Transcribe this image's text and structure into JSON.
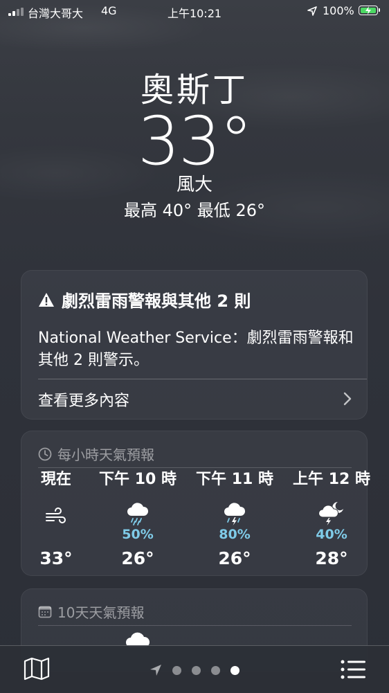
{
  "status_bar": {
    "carrier": "台灣大哥大",
    "network": "4G",
    "time": "上午10:21",
    "battery": "100%"
  },
  "location": {
    "city": "奧斯丁",
    "temperature": "33°",
    "condition": "風大",
    "high_low": "最高 40°  最低 26°"
  },
  "alert": {
    "title": "劇烈雷雨警報與其他 2 則",
    "body": "National Weather Service：劇烈雷雨警報和其他 2 則警示。",
    "more_label": "查看更多內容",
    "icon": "warning-triangle-icon"
  },
  "hourly": {
    "title": "每小時天氣預報",
    "icon": "clock-icon",
    "items": [
      {
        "time": "現在",
        "icon": "wind-icon",
        "pop": "",
        "temp": "33°"
      },
      {
        "time": "下午 10 時",
        "icon": "rain-cloud-icon",
        "pop": "50%",
        "temp": "26°"
      },
      {
        "time": "下午 11 時",
        "icon": "thunderstorm-cloud-icon",
        "pop": "80%",
        "temp": "26°"
      },
      {
        "time": "上午 12 時",
        "icon": "moon-thunderstorm-icon",
        "pop": "40%",
        "temp": "28°"
      }
    ]
  },
  "ten_day": {
    "title": "10天天氣預報",
    "icon": "calendar-icon"
  },
  "toolbar": {
    "map_icon": "map-icon",
    "list_icon": "list-icon",
    "page_count": 4,
    "active_page": 4
  },
  "colors": {
    "precip": "#7fcbe8",
    "battery": "#4cd964"
  }
}
